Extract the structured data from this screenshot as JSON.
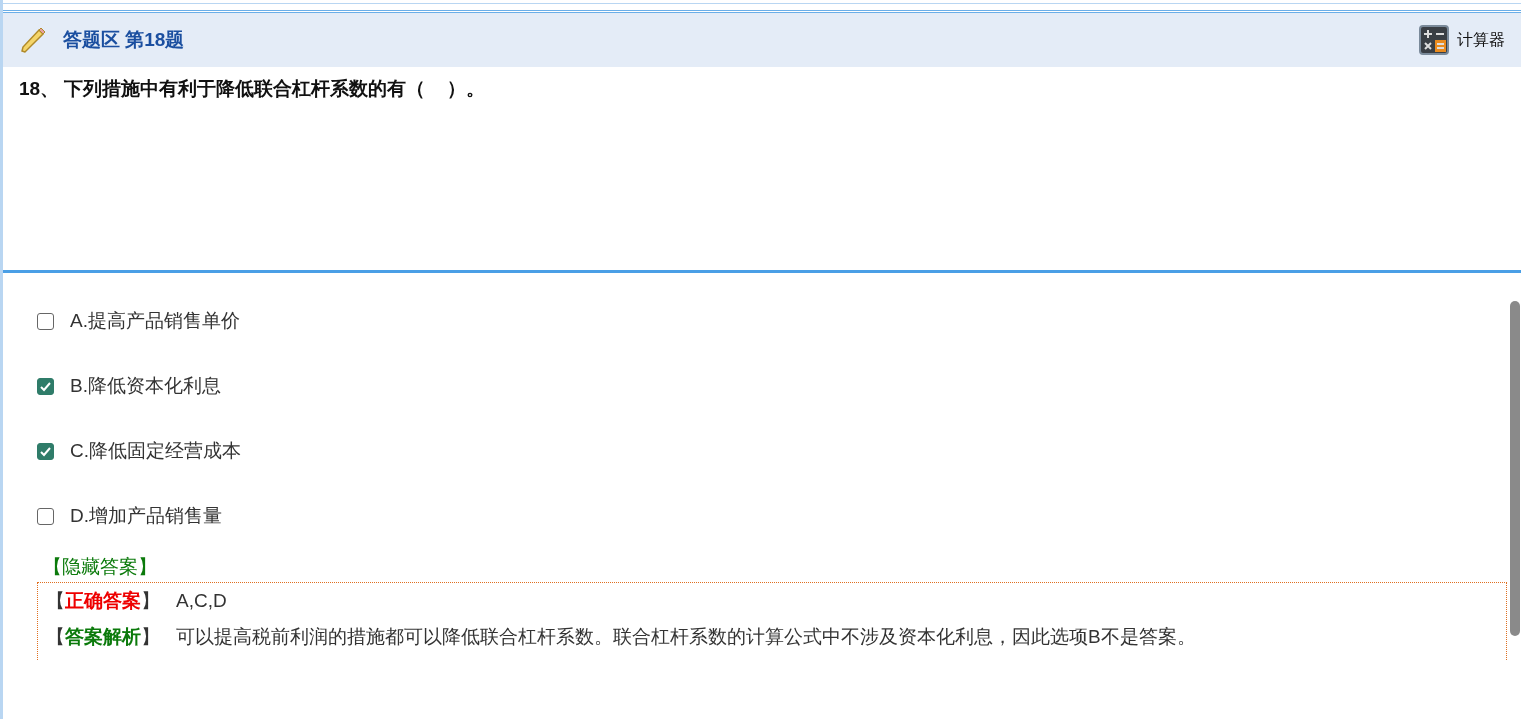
{
  "header": {
    "title": "答题区 第18题",
    "calculator": "计算器"
  },
  "question": {
    "number": "18、",
    "text": "下列措施中有利于降低联合杠杆系数的有（    ）。"
  },
  "options": [
    {
      "label": "A.提高产品销售单价",
      "checked": false
    },
    {
      "label": "B.降低资本化利息",
      "checked": true
    },
    {
      "label": "C.降低固定经营成本",
      "checked": true
    },
    {
      "label": "D.增加产品销售量",
      "checked": false
    }
  ],
  "hide_answer": "【隐藏答案】",
  "answer_rows": [
    {
      "kind": "correct",
      "open": "【",
      "label": "正确答案",
      "close": "】",
      "text": "A,C,D"
    },
    {
      "kind": "analysis",
      "open": "【",
      "label": "答案解析",
      "close": "】",
      "text": "可以提高税前利润的措施都可以降低联合杠杆系数。联合杠杆系数的计算公式中不涉及资本化利息，因此选项B不是答案。"
    }
  ]
}
